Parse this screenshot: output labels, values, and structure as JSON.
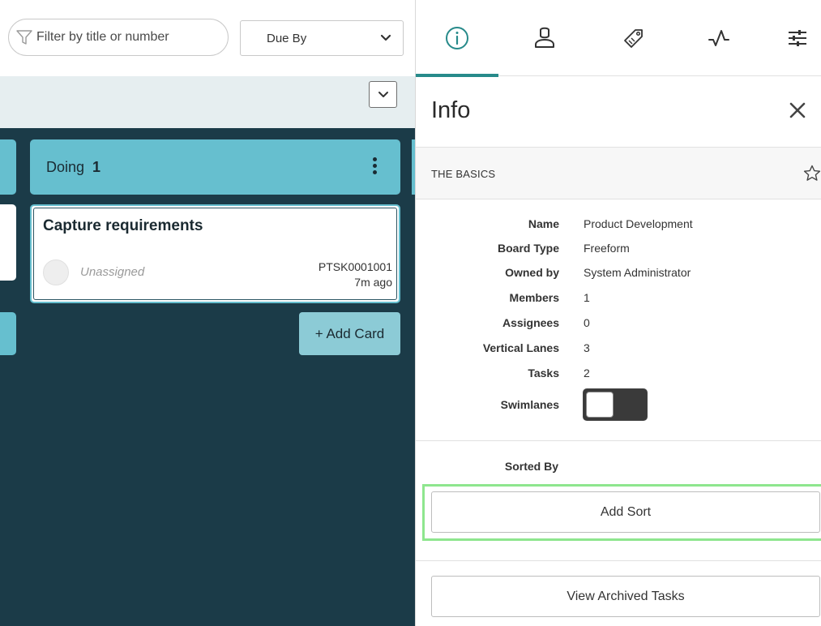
{
  "toolbar": {
    "filter_placeholder": "Filter by title or number",
    "sort_select_value": "Due By"
  },
  "lanes": [
    {
      "title": "Doing",
      "count": "1",
      "cards": [
        {
          "title": "Capture requirements",
          "assignee": "Unassigned",
          "number": "PTSK0001001",
          "age": "7m ago"
        }
      ],
      "add_card_label": "+ Add Card"
    }
  ],
  "panel": {
    "tabs": [
      {
        "icon": "info-icon",
        "active": true
      },
      {
        "icon": "members-icon",
        "active": false
      },
      {
        "icon": "tag-icon",
        "active": false
      },
      {
        "icon": "activity-icon",
        "active": false
      },
      {
        "icon": "sliders-icon",
        "active": false
      }
    ],
    "title": "Info",
    "section_title": "THE BASICS",
    "fields": [
      {
        "label": "Name",
        "value": "Product Development"
      },
      {
        "label": "Board Type",
        "value": "Freeform"
      },
      {
        "label": "Owned by",
        "value": "System Administrator"
      },
      {
        "label": "Members",
        "value": "1"
      },
      {
        "label": "Assignees",
        "value": "0"
      },
      {
        "label": "Vertical Lanes",
        "value": "3"
      },
      {
        "label": "Tasks",
        "value": "2"
      }
    ],
    "swimlanes_label": "Swimlanes",
    "swimlanes_on": false,
    "sorted_by_label": "Sorted By",
    "add_sort_label": "Add Sort",
    "archived_label": "View Archived Tasks"
  },
  "colors": {
    "board_background": "#1b3b48",
    "lane_header": "#66bfcf",
    "active_tab_accent": "#278a8a",
    "highlight": "#8ee68e"
  }
}
